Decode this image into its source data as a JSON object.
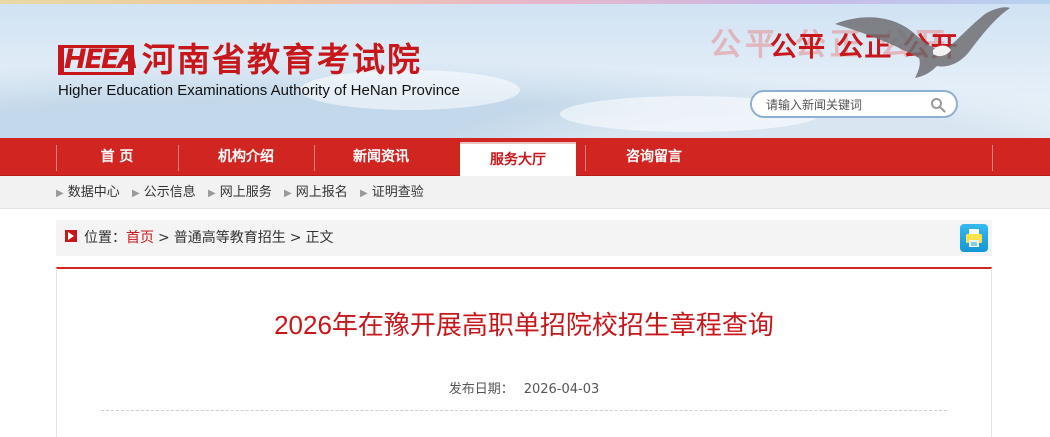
{
  "header": {
    "logo_text": "HEEA",
    "title_cn": "河南省教育考试院",
    "title_en": "Higher Education Examinations Authority of HeNan Province",
    "slogan": "公平 公正 公开",
    "slogan_ghost": "公平 公正 公开",
    "search": {
      "placeholder": "请输入新闻关键词",
      "value": ""
    }
  },
  "nav": {
    "items": [
      {
        "label": "首 页",
        "active": false
      },
      {
        "label": "机构介绍",
        "active": false
      },
      {
        "label": "新闻资讯",
        "active": false
      },
      {
        "label": "服务大厅",
        "active": true
      },
      {
        "label": "咨询留言",
        "active": false
      }
    ]
  },
  "subnav": {
    "items": [
      {
        "label": "数据中心"
      },
      {
        "label": "公示信息"
      },
      {
        "label": "网上服务"
      },
      {
        "label": "网上报名"
      },
      {
        "label": "证明查验"
      }
    ]
  },
  "location": {
    "prefix": "位置：",
    "home": "首页",
    "separator": ">",
    "category": "普通高等教育招生",
    "current": "正文"
  },
  "article": {
    "title": "2026年在豫开展高职单招院校招生章程查询",
    "date_label": "发布日期：",
    "date": "2026-04-03"
  },
  "colors": {
    "brand_red": "#c8171b",
    "nav_red": "#d12521",
    "print_blue": "#1597d4"
  },
  "icons": [
    "search-icon",
    "print-icon",
    "location-arrow-icon",
    "chevron-right-icon",
    "eagle-icon"
  ]
}
